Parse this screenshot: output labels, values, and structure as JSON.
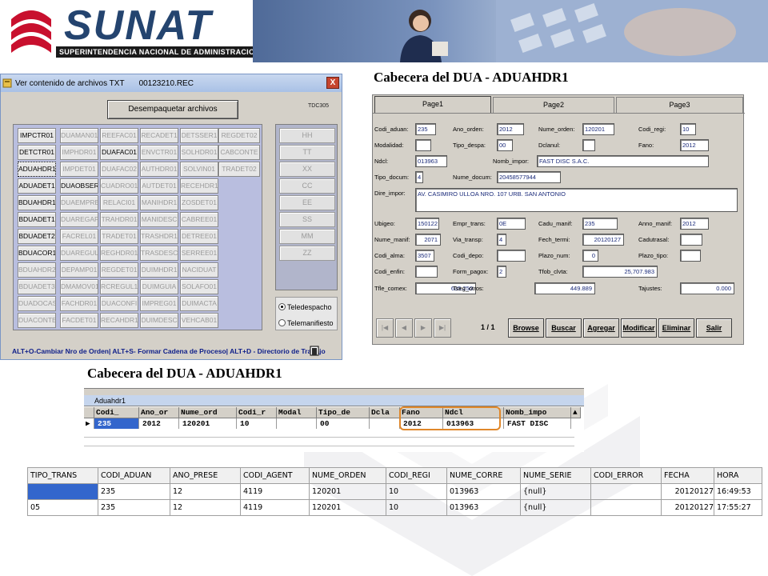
{
  "banner": {
    "logo": "SUNAT",
    "subtitle": "SUPERINTENDENCIA NACIONAL DE ADMINISTRACION TRIBUTARIA"
  },
  "window1": {
    "title": "Ver contenido de archivos TXT",
    "filename": "00123210.REC",
    "unpack_button": "Desempaquetar archivos",
    "tdc_label": "TDC305",
    "close_label": "X",
    "grid": [
      [
        {
          "label": "IMPCTR01",
          "active": true
        },
        {
          "label": "DUAMAN01",
          "active": false
        },
        {
          "label": "REEFAC01",
          "active": false
        },
        {
          "label": "RECADET1",
          "active": false
        },
        {
          "label": "DETSSER1",
          "active": false
        },
        {
          "label": "REGDET02",
          "active": false
        }
      ],
      [
        {
          "label": "DETCTR01",
          "active": true
        },
        {
          "label": "IMPHDR01",
          "active": false
        },
        {
          "label": "DUAFAC01",
          "active": true
        },
        {
          "label": "ENVCTR01",
          "active": false
        },
        {
          "label": "SOLHDR01",
          "active": false
        },
        {
          "label": "CABCONTE",
          "active": false
        }
      ],
      [
        {
          "label": "ADUAHDR1",
          "active": true,
          "focused": true
        },
        {
          "label": "IMPDET01",
          "active": false
        },
        {
          "label": "DUAFAC02",
          "active": false
        },
        {
          "label": "AUTHDR01",
          "active": false
        },
        {
          "label": "SOLVIN01",
          "active": false
        },
        {
          "label": "TRADET02",
          "active": false
        }
      ],
      [
        {
          "label": "ADUADET1",
          "active": true
        },
        {
          "label": "DUAOBSER",
          "active": true
        },
        {
          "label": "CUADRO01",
          "active": false
        },
        {
          "label": "AUTDET01",
          "active": false
        },
        {
          "label": "RECEHDR1",
          "active": false
        }
      ],
      [
        {
          "label": "BDUAHDR1",
          "active": true
        },
        {
          "label": "DUAEMPRE",
          "active": false
        },
        {
          "label": "RELACI01",
          "active": false
        },
        {
          "label": "MANIHDR1",
          "active": false
        },
        {
          "label": "ZOSDET01",
          "active": false
        }
      ],
      [
        {
          "label": "BDUADET1",
          "active": true
        },
        {
          "label": "DUAREGAP",
          "active": false
        },
        {
          "label": "TRAHDR01",
          "active": false
        },
        {
          "label": "MANIDESC",
          "active": false
        },
        {
          "label": "CABREE01",
          "active": false
        }
      ],
      [
        {
          "label": "BDUADET2",
          "active": true
        },
        {
          "label": "FACREL01",
          "active": false
        },
        {
          "label": "TRADET01",
          "active": false
        },
        {
          "label": "TRASHDR1",
          "active": false
        },
        {
          "label": "DETREE01",
          "active": false
        }
      ],
      [
        {
          "label": "BDUACOR1",
          "active": true
        },
        {
          "label": "DUAREGUL",
          "active": false
        },
        {
          "label": "REGHDR01",
          "active": false
        },
        {
          "label": "TRASDESC",
          "active": false
        },
        {
          "label": "SERREE01",
          "active": false
        }
      ],
      [
        {
          "label": "BDUAHDR2",
          "active": false
        },
        {
          "label": "DEPAMP01",
          "active": false
        },
        {
          "label": "REGDET01",
          "active": false
        },
        {
          "label": "DUIMHDR1",
          "active": false
        },
        {
          "label": "NACIDUAT",
          "active": false
        }
      ],
      [
        {
          "label": "BDUADET3",
          "active": false
        },
        {
          "label": "DMAMOV01",
          "active": false
        },
        {
          "label": "RCREGUL1",
          "active": false
        },
        {
          "label": "DUIMGUIA",
          "active": false
        },
        {
          "label": "SOLAFO01",
          "active": false
        }
      ],
      [
        {
          "label": "DUADOCAS",
          "active": false
        },
        {
          "label": "FACHDR01",
          "active": false
        },
        {
          "label": "DUACONFI",
          "active": false
        },
        {
          "label": "IMPREG01",
          "active": false
        },
        {
          "label": "DUIMACTA",
          "active": false
        }
      ],
      [
        {
          "label": "DUACONTE",
          "active": false
        },
        {
          "label": "FACDET01",
          "active": false
        },
        {
          "label": "RECAHDR1",
          "active": false
        },
        {
          "label": "DUIMDESC",
          "active": false
        },
        {
          "label": "VEHCAB01",
          "active": false
        }
      ]
    ],
    "right_buttons": [
      "HH",
      "TT",
      "XX",
      "CC",
      "EE",
      "SS",
      "MM",
      "ZZ"
    ],
    "radio": [
      {
        "label": "Teledespacho",
        "checked": true
      },
      {
        "label": "Telemanifiesto",
        "checked": false
      }
    ],
    "footer": "ALT+O-Cambiar Nro de Orden| ALT+S- Formar Cadena de Proceso| ALT+D - Directorio de Trabajo"
  },
  "window2": {
    "title": "Cabecera del DUA - ADUAHDR1",
    "tabs": [
      "Page1",
      "Page2",
      "Page3"
    ],
    "fields": {
      "codi_aduan": {
        "label": "Codi_aduan:",
        "value": "235"
      },
      "ano_orden": {
        "label": "Ano_orden:",
        "value": "2012"
      },
      "nume_orden": {
        "label": "Nume_orden:",
        "value": "120201"
      },
      "codi_regi": {
        "label": "Codi_regi:",
        "value": "10"
      },
      "modalidad": {
        "label": "Modalidad:",
        "value": ""
      },
      "tipo_despa": {
        "label": "Tipo_despa:",
        "value": "00"
      },
      "dclanul": {
        "label": "Dclanul:",
        "value": ""
      },
      "fano": {
        "label": "Fano:",
        "value": "2012"
      },
      "ndcl": {
        "label": "Ndcl:",
        "value": "013963"
      },
      "nomb_impor": {
        "label": "Nomb_impor:",
        "value": "FAST DISC S.A.C."
      },
      "tipo_docum": {
        "label": "Tipo_docum:",
        "value": "4"
      },
      "nume_docum": {
        "label": "Nume_docum:",
        "value": "20458577944"
      },
      "dire_impor": {
        "label": "Dire_impor:",
        "value": "AV. CASIMIRO ULLOA NRO. 107 URB. SAN ANTONIO"
      },
      "ubigeo": {
        "label": "Ubigeo:",
        "value": "150122"
      },
      "empr_trans": {
        "label": "Empr_trans:",
        "value": "0E"
      },
      "cadu_manif": {
        "label": "Cadu_manif:",
        "value": "235"
      },
      "anno_manif": {
        "label": "Anno_manif:",
        "value": "2012"
      },
      "nume_manif": {
        "label": "Nume_manif:",
        "value": "2071"
      },
      "via_transp": {
        "label": "Via_transp:",
        "value": "4"
      },
      "fech_termi": {
        "label": "Fech_termi:",
        "value": "20120127"
      },
      "cadutrasal": {
        "label": "Cadutrasal:",
        "value": ""
      },
      "codi_alma": {
        "label": "Codi_alma:",
        "value": "3507"
      },
      "codi_depo": {
        "label": "Codi_depo:",
        "value": ""
      },
      "plazo_num": {
        "label": "Plazo_num:",
        "value": "0"
      },
      "plazo_tipo": {
        "label": "Plazo_tipo:",
        "value": ""
      },
      "codi_enfin": {
        "label": "Codi_enfin:",
        "value": ""
      },
      "form_pagox": {
        "label": "Form_pagox:",
        "value": "2"
      },
      "tfob_clvta": {
        "label": "Tfob_clvta:",
        "value": "25,707.983"
      },
      "tfle_comex": {
        "label": "Tfle_comex:",
        "value": "635.250"
      },
      "tseg_otros": {
        "label": "Tseg_otros:",
        "value": "449.889"
      },
      "tajustes": {
        "label": "Tajustes:",
        "value": "0.000"
      }
    },
    "nav": {
      "count": "1 / 1",
      "buttons": [
        "Browse",
        "Buscar",
        "Agregar",
        "Modificar",
        "Eliminar",
        "Salir"
      ]
    }
  },
  "window3": {
    "title": "Cabecera del DUA - ADUAHDR1",
    "grid_title": "Aduahdr1",
    "headers": [
      "Codi_",
      "Ano_or",
      "Nume_ord",
      "Codi_r",
      "Modal",
      "Tipo_de",
      "Dcla",
      "Fano",
      "Ndcl",
      "Nomb_impo"
    ],
    "row": [
      "235",
      "2012",
      "120201",
      "10",
      "",
      "00",
      "",
      "2012",
      "013963",
      "FAST DISC"
    ]
  },
  "table4": {
    "headers": [
      "TIPO_TRANS",
      "CODI_ADUAN",
      "ANO_PRESE",
      "CODI_AGENT",
      "NUME_ORDEN",
      "CODI_REGI",
      "NUME_CORRE",
      "NUME_SERIE",
      "CODI_ERROR",
      "FECHA",
      "HORA"
    ],
    "rows": [
      [
        "",
        "235",
        "12",
        "4119",
        "120201",
        "10",
        "013963",
        "{null}",
        "",
        "20120127",
        "16:49:53"
      ],
      [
        "05",
        "235",
        "12",
        "4119",
        "120201",
        "10",
        "013963",
        "{null}",
        "",
        "20120127",
        "17:55:27"
      ]
    ]
  },
  "colors": {
    "brand_blue": "#24446f",
    "highlight": "#e0872a",
    "selection": "#3366cc"
  }
}
